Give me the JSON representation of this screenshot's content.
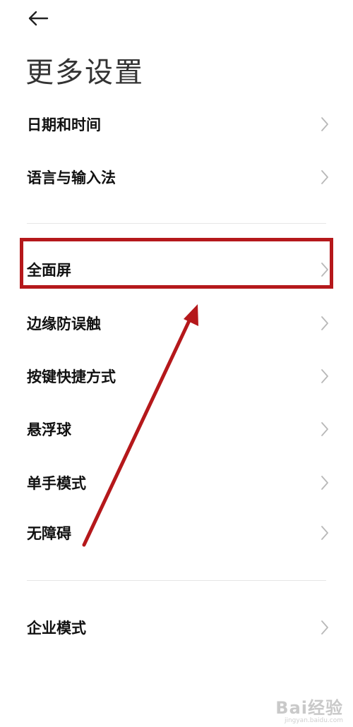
{
  "header": {
    "back_icon": "arrow-left-icon",
    "title": "更多设置"
  },
  "groups": [
    {
      "items": [
        {
          "label": "日期和时间",
          "icon": "chevron-right-icon"
        },
        {
          "label": "语言与输入法",
          "icon": "chevron-right-icon"
        }
      ]
    },
    {
      "items": [
        {
          "label": "全面屏",
          "icon": "chevron-right-icon",
          "highlighted": true
        },
        {
          "label": "边缘防误触",
          "icon": "chevron-right-icon"
        },
        {
          "label": "按键快捷方式",
          "icon": "chevron-right-icon"
        },
        {
          "label": "悬浮球",
          "icon": "chevron-right-icon"
        },
        {
          "label": "单手模式",
          "icon": "chevron-right-icon"
        },
        {
          "label": "无障碍",
          "icon": "chevron-right-icon"
        }
      ]
    },
    {
      "items": [
        {
          "label": "企业模式",
          "icon": "chevron-right-icon"
        }
      ]
    }
  ],
  "annotation": {
    "color": "#b5181b",
    "type": "highlight-box-with-arrow"
  },
  "watermark": {
    "main": "Bai经验",
    "sub": "jingyan.baidu.com"
  }
}
